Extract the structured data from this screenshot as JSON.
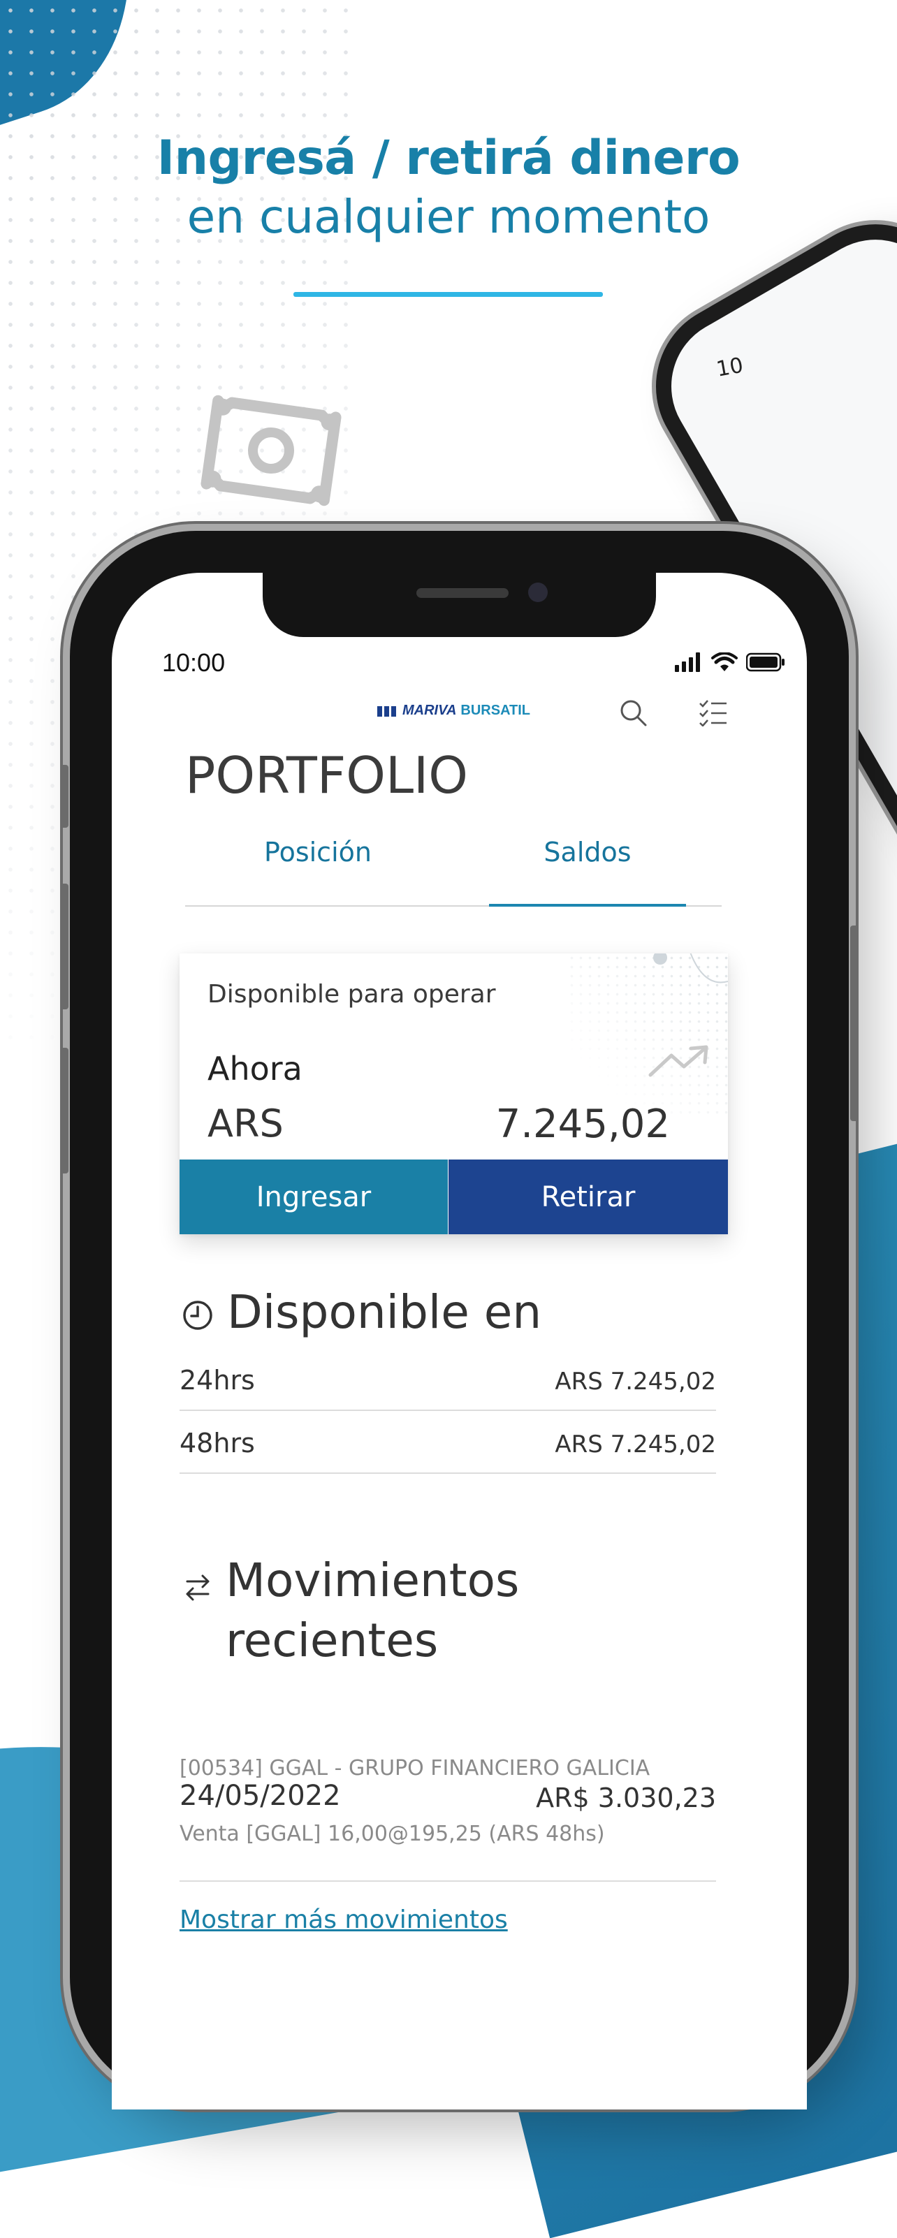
{
  "headline": {
    "line1": "Ingresá / retirá dinero",
    "line2": "en cualquier momento"
  },
  "background_phone": {
    "time_fragment": "10"
  },
  "status_bar": {
    "time": "10:00"
  },
  "header": {
    "logo_mark": "MARIVA",
    "logo_text": "BURSATIL",
    "search_icon": "search-icon",
    "checklist_icon": "checklist-icon"
  },
  "page": {
    "title": "PORTFOLIO"
  },
  "tabs": [
    {
      "label": "Posición",
      "active": false
    },
    {
      "label": "Saldos",
      "active": true
    }
  ],
  "balance_card": {
    "label": "Disponible para operar",
    "period": "Ahora",
    "currency": "ARS",
    "amount": "7.245,02",
    "deposit_label": "Ingresar",
    "withdraw_label": "Retirar"
  },
  "available_in": {
    "title": "Disponible en",
    "icon": "clock-icon",
    "rows": [
      {
        "period": "24hrs",
        "amount": "ARS 7.245,02"
      },
      {
        "period": "48hrs",
        "amount": "ARS 7.245,02"
      }
    ]
  },
  "recent_movements": {
    "title_line1": "Movimientos",
    "title_line2": "recientes",
    "icon": "swap-arrows-icon",
    "items": [
      {
        "reference": "[00534] GGAL - GRUPO FINANCIERO GALICIA",
        "date": "24/05/2022",
        "amount": "AR$ 3.030,23",
        "description": "Venta [GGAL] 16,00@195,25 (ARS 48hs)"
      }
    ],
    "show_more_label": "Mostrar más movimientos"
  },
  "colors": {
    "brand_blue": "#1880a8",
    "accent_cyan": "#2fb6e5",
    "deposit_button": "#1a80a6",
    "withdraw_button": "#1d4490"
  }
}
